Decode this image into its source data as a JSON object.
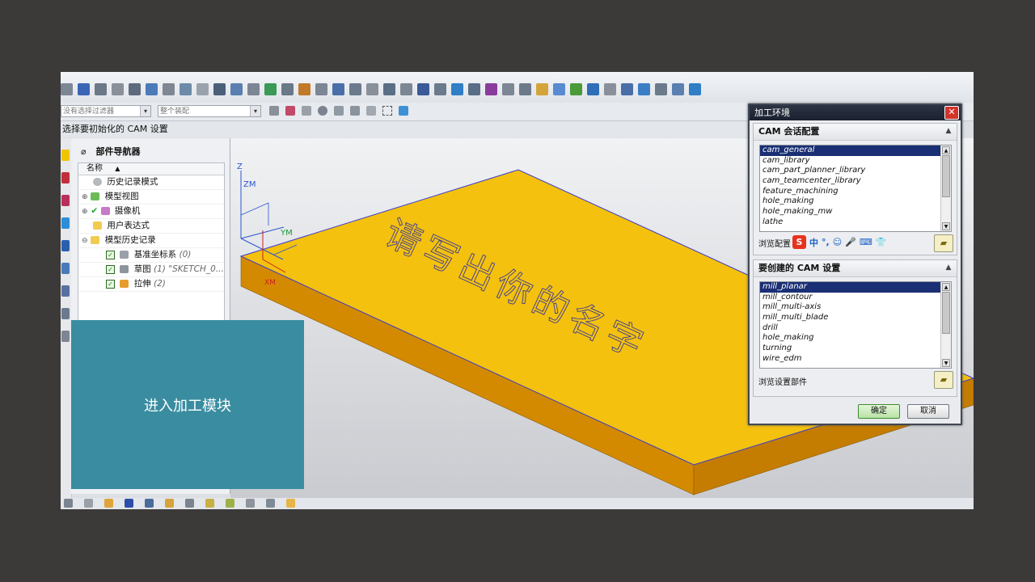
{
  "toolbar": {
    "filter_placeholder": "没有选择过滤器",
    "scope": "整个装配"
  },
  "cue_line": "选择要初始化的 CAM 设置",
  "navigator": {
    "title": "部件导航器",
    "column_header": "名称",
    "items": [
      {
        "label": "历史记录模式",
        "indent": 1
      },
      {
        "label": "模型视图",
        "indent": 0
      },
      {
        "label": "摄像机",
        "indent": 0
      },
      {
        "label": "用户表达式",
        "indent": 1
      },
      {
        "label": "模型历史记录",
        "indent": 0
      },
      {
        "label": "基准坐标系",
        "suffix": "(0)"
      },
      {
        "label": "草图",
        "suffix": "(1) \"SKETCH_0..."
      },
      {
        "label": "拉伸",
        "suffix": "(2)"
      }
    ]
  },
  "viewport": {
    "engraved_text": "请写出你的名字",
    "axis_labels": {
      "z": "Z",
      "zm": "ZM",
      "ym": "YM",
      "xm": "XM"
    }
  },
  "overlay": {
    "text": "进入加工模块"
  },
  "dialog": {
    "title": "加工环境",
    "close_glyph": "✕",
    "session_group": {
      "header": "CAM 会话配置",
      "items": [
        "cam_general",
        "cam_library",
        "cam_part_planner_library",
        "cam_teamcenter_library",
        "feature_machining",
        "hole_making",
        "hole_making_mw",
        "lathe"
      ],
      "selected_index": 0,
      "browse_label": "浏览配置"
    },
    "setup_group": {
      "header": "要创建的 CAM 设置",
      "items": [
        "mill_planar",
        "mill_contour",
        "mill_multi-axis",
        "mill_multi_blade",
        "drill",
        "hole_making",
        "turning",
        "wire_edm"
      ],
      "selected_index": 0,
      "browse_label": "浏览设置部件"
    },
    "ok_label": "确定",
    "cancel_label": "取消"
  },
  "ime_toolbar": [
    "S",
    "中",
    "°,",
    "☺",
    "🎤",
    "⌨",
    "👕"
  ],
  "colors": {
    "part_top": "#f4c10e",
    "part_side": "#d38a00",
    "overlay_bg": "#3a8da0",
    "dialog_title_bg": "#1b2130",
    "selection_bg": "#1a2f74"
  }
}
